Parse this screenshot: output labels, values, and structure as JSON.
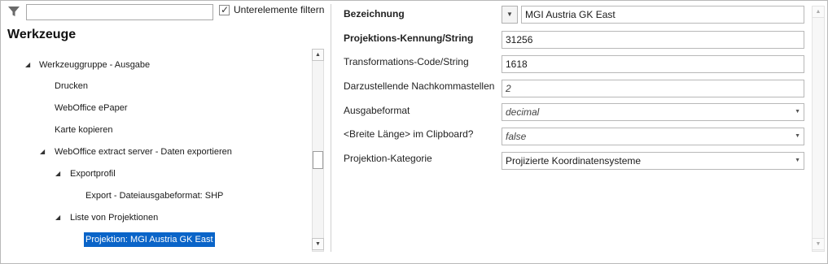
{
  "filter": {
    "icon": "filter-icon",
    "value": "",
    "checkbox_label": "Unterelemente filtern",
    "checked": true
  },
  "panel_title": "Werkzeuge",
  "tree": [
    {
      "label": "Werkzeuggruppe - Ausgabe",
      "expanded": true
    },
    {
      "label": "Drucken"
    },
    {
      "label": "WebOffice ePaper"
    },
    {
      "label": "Karte kopieren"
    },
    {
      "label": "WebOffice extract server - Daten exportieren",
      "expanded": true
    },
    {
      "label": "Exportprofil",
      "expanded": true
    },
    {
      "label": "Export - Dateiausgabeformat: SHP"
    },
    {
      "label": "Liste von Projektionen",
      "expanded": true
    },
    {
      "label": "Projektion: MGI Austria GK East",
      "selected": true
    }
  ],
  "properties": [
    {
      "label": "Bezeichnung",
      "value": "MGI Austria GK East"
    },
    {
      "label": "Projektions-Kennung/String",
      "value": "31256"
    },
    {
      "label": "Transformations-Code/String",
      "value": "1618"
    },
    {
      "label": "Darzustellende Nachkommastellen",
      "value": "2"
    },
    {
      "label": "Ausgabeformat",
      "value": "decimal"
    },
    {
      "label": "<Breite Länge> im Clipboard?",
      "value": "false"
    },
    {
      "label": "Projektion-Kategorie",
      "value": "Projizierte Koordinatensysteme"
    }
  ],
  "colors": {
    "selection": "#0a64c8",
    "border": "#b8b8b8"
  }
}
